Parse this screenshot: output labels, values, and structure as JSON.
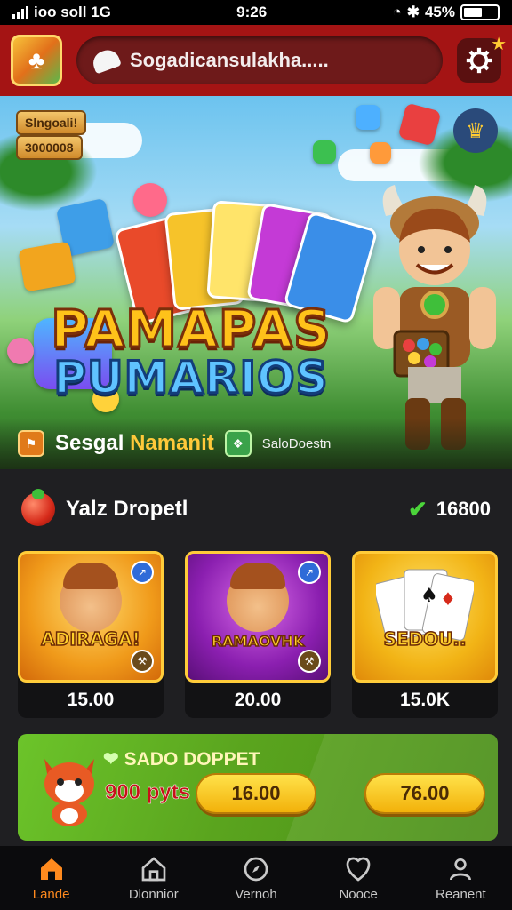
{
  "status_bar": {
    "carrier": "ioo soll 1G",
    "time": "9:26",
    "battery": "45%"
  },
  "header": {
    "search_text": "Sogadicansulakha....."
  },
  "hero": {
    "tag1": "Slngoali!",
    "tag2": "3000008",
    "title_line1": "PAMAPAS",
    "title_line2": "PUMARIOS",
    "label_main": "Sesgal",
    "label_highlight": "Namanit",
    "label_sub": "SaloDoestn"
  },
  "section": {
    "title": "Yalz Dropetl",
    "value": "16800"
  },
  "tiles": [
    {
      "label": "ADIRAGA!",
      "price": "15.00",
      "bg": "#f09a1a"
    },
    {
      "label": "RAMAOVHK",
      "price": "20.00",
      "bg": "#8b1fb0"
    },
    {
      "label": "SEDOU..",
      "price": "15.0K",
      "bg": "#f2b416"
    }
  ],
  "promo": {
    "title": "SADO DOPPET",
    "points": "900 pyts",
    "btn1": "16.00",
    "btn2": "76.00"
  },
  "nav": [
    {
      "label": "Lande",
      "icon": "home-icon",
      "active": true
    },
    {
      "label": "Dlonnior",
      "icon": "store-icon",
      "active": false
    },
    {
      "label": "Vernoh",
      "icon": "compass-icon",
      "active": false
    },
    {
      "label": "Nooce",
      "icon": "shield-icon",
      "active": false
    },
    {
      "label": "Reanent",
      "icon": "profile-icon",
      "active": false
    }
  ],
  "colors": {
    "header": "#a41414",
    "accent": "#ff8a1e",
    "promo": "#5aa41e"
  }
}
